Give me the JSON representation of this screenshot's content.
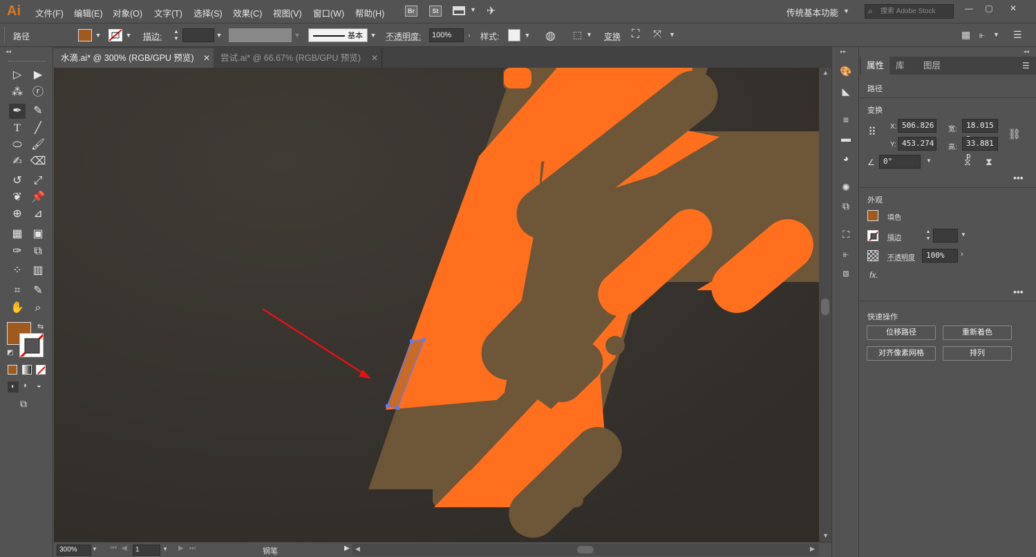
{
  "app": {
    "logo": "Ai"
  },
  "menu": [
    "文件(F)",
    "编辑(E)",
    "对象(O)",
    "文字(T)",
    "选择(S)",
    "效果(C)",
    "视图(V)",
    "窗口(W)",
    "帮助(H)"
  ],
  "menubar_icons": {
    "bridge": "Br",
    "stock": "St"
  },
  "workspace": "传统基本功能",
  "search_placeholder": "搜索 Adobe Stock",
  "control": {
    "selection_type": "路径",
    "stroke_label": "描边:",
    "stroke_profile": "基本",
    "opacity_label": "不透明度:",
    "opacity_value": "100%",
    "style_label": "样式:",
    "transform_label": "变换",
    "fill_color": "#a05a1e"
  },
  "tabs": [
    {
      "label": "水滴.ai* @ 300% (RGB/GPU 预览)",
      "active": true
    },
    {
      "label": "尝试.ai* @ 66.67% (RGB/GPU 预览)",
      "active": false
    }
  ],
  "status": {
    "zoom": "300%",
    "artboard": "1",
    "tool": "钢笔"
  },
  "panel": {
    "tabs": [
      "属性",
      "库",
      "图层"
    ],
    "selection": "路径",
    "transform_title": "变换",
    "x_label": "X:",
    "x": "506.826",
    "y_label": "Y:",
    "y": "453.274",
    "w_label": "宽:",
    "w": "18.015 p",
    "h_label": "高:",
    "h": "33.881 p",
    "angle": "0°",
    "appearance_title": "外观",
    "fill_label": "填色",
    "stroke_label": "描边",
    "opacity_label": "不透明度",
    "opacity_value": "100%",
    "fx": "fx.",
    "quick_title": "快速操作",
    "buttons": [
      "位移路径",
      "重新着色",
      "对齐像素网格",
      "排列"
    ]
  },
  "colors": {
    "orange": "#ff6f1e",
    "brown": "#6e5638",
    "canvas": "#3b3732",
    "fill_swatch": "#a05a1e",
    "selection": "#5b7bff",
    "arrow": "#e01414"
  }
}
